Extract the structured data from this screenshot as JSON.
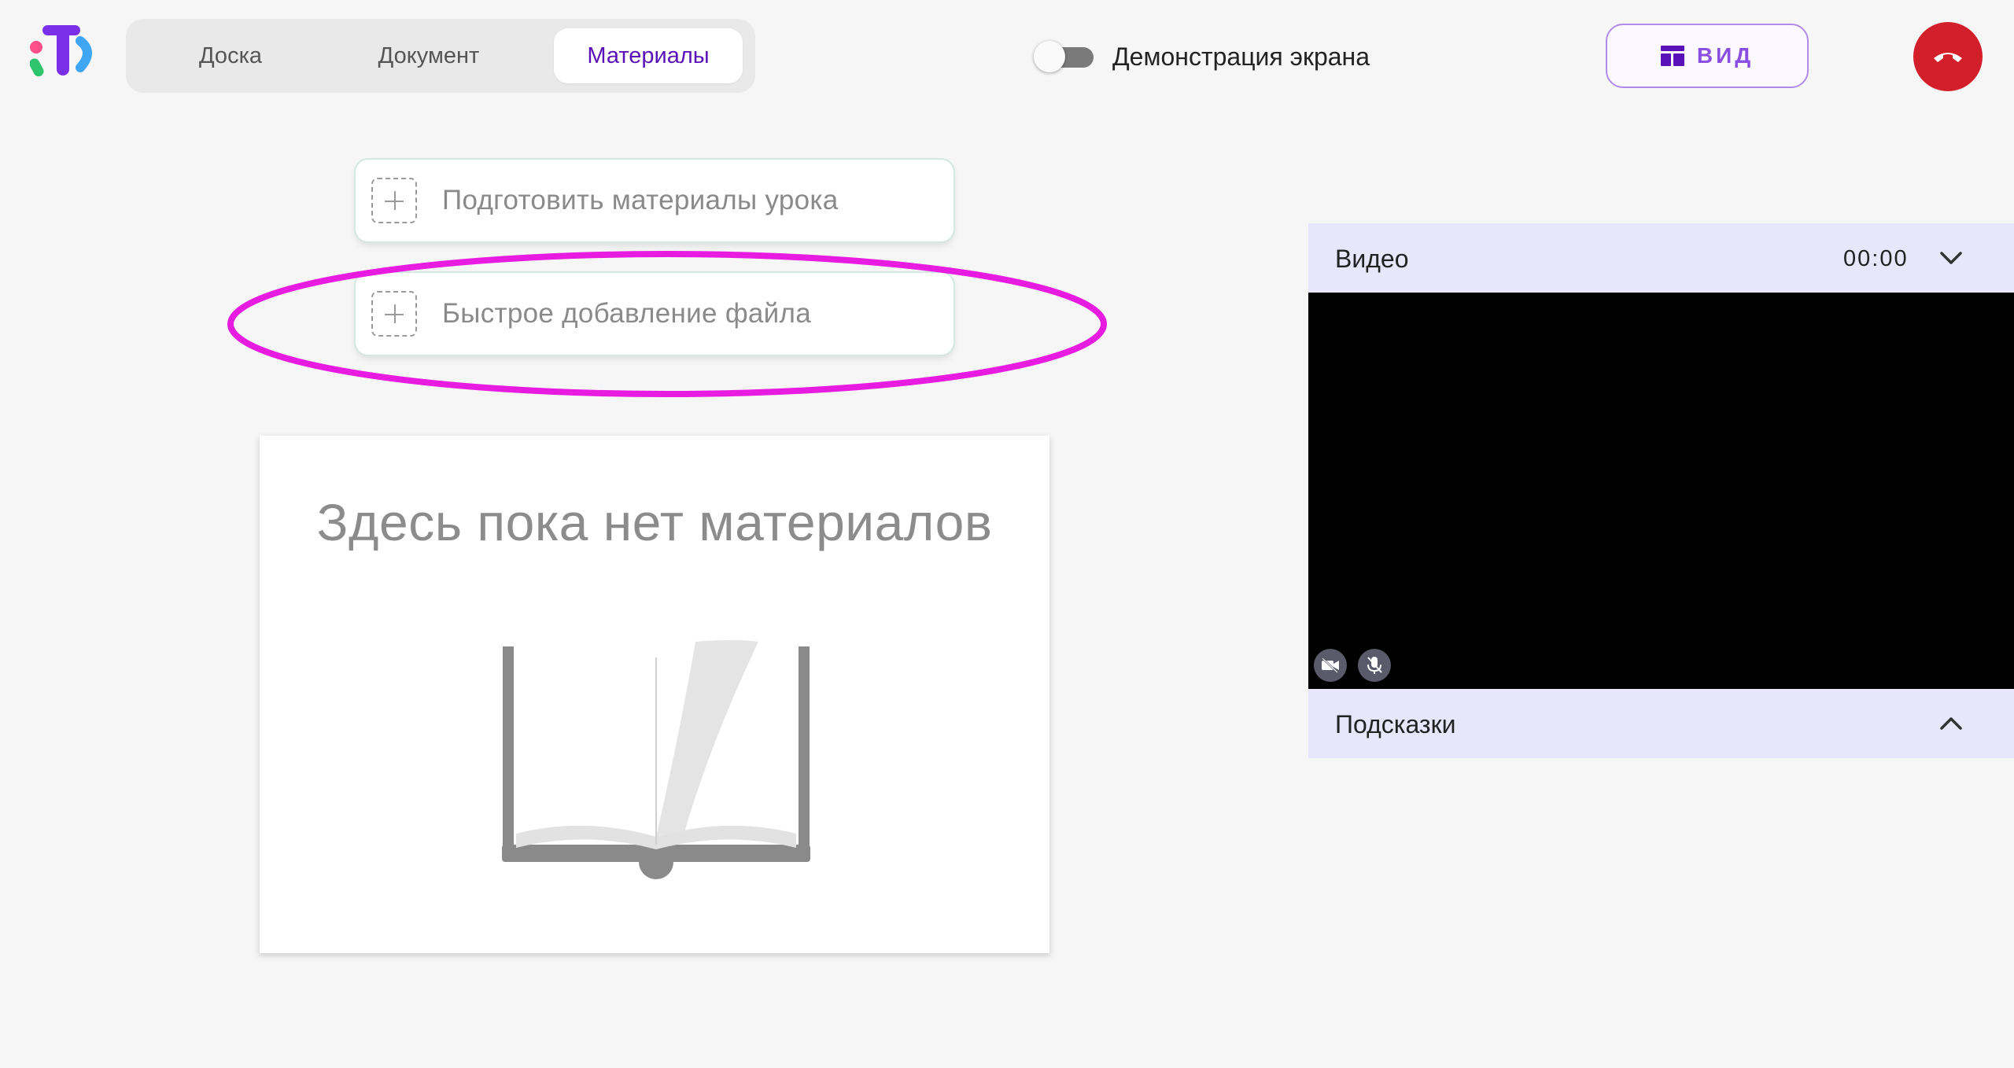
{
  "tabs": [
    {
      "label": "Доска",
      "active": false
    },
    {
      "label": "Документ",
      "active": false
    },
    {
      "label": "Материалы",
      "active": true
    }
  ],
  "screen_share": {
    "label": "Демонстрация экрана",
    "enabled": false
  },
  "view_button": {
    "label": "ВИД"
  },
  "actions": {
    "prepare_label": "Подготовить материалы урока",
    "quick_add_label": "Быстрое добавление файла"
  },
  "empty_state": {
    "message": "Здесь пока нет материалов"
  },
  "video_panel": {
    "title": "Видео",
    "timer": "00:00",
    "camera": "off",
    "microphone": "off"
  },
  "hints_panel": {
    "title": "Подсказки"
  },
  "colors": {
    "accent": "#5a12b8",
    "view_button": "#8a4fe0",
    "end_call": "#d21f2b",
    "highlight": "#e81be0",
    "panel_header": "#e8e6fb"
  },
  "icons": [
    "app-logo",
    "view-layout-icon",
    "hang-up-icon",
    "add-icon",
    "book-icon",
    "chevron-down-icon",
    "chevron-up-icon",
    "camera-off-icon",
    "mic-off-icon"
  ]
}
